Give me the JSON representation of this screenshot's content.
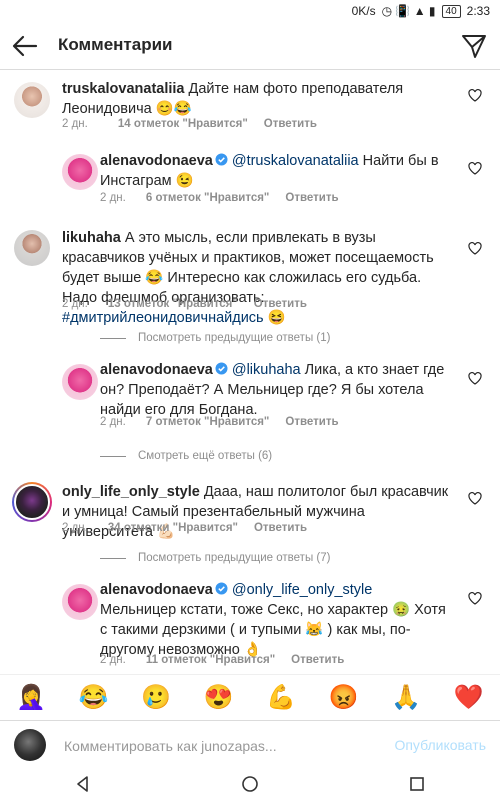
{
  "status": {
    "speed": "0K/s",
    "battery": "40",
    "time": "2:33"
  },
  "header": {
    "title": "Комментарии"
  },
  "comments": [
    {
      "user": "truskalovanataliia",
      "text": "Дайте нам фото преподавателя Леонидовича 😊😂",
      "time": "2 дн.",
      "likes": "14 отметок \"Нравится\"",
      "reply": "Ответить"
    },
    {
      "user": "alenavodonaeva",
      "mention": "@truskalovanataliia",
      "text": " Найти бы в Инстаграм 😉",
      "time": "2 дн.",
      "likes": "6 отметок \"Нравится\"",
      "reply": "Ответить"
    },
    {
      "user": "likuhaha",
      "text": "А это мысль, если привлекать в вузы красавчиков учёных и практиков, может посещаемость будет выше 😂 Интересно как сложилась его судьба. Надо флешмоб организовать: ",
      "hashtag": "#дмитрийлеонидовичнайдись",
      "text2": " 😆",
      "time": "2 дн.",
      "likes": "13 отметок \"Нравится\"",
      "reply": "Ответить"
    },
    {
      "user": "alenavodonaeva",
      "mention": "@likuhaha",
      "text": " Лика, а кто знает где он? Преподаёт? А Мельницер где? Я бы хотела найди его для Богдана.",
      "time": "2 дн.",
      "likes": "7 отметок \"Нравится\"",
      "reply": "Ответить"
    },
    {
      "user": "only_life_only_style",
      "text": "Дааа, наш политолог был красавчик и умница! Самый презентабельный мужчина университета 💪🏻",
      "time": "2 дн.",
      "likes": "34 отметки \"Нравится\"",
      "reply": "Ответить"
    },
    {
      "user": "alenavodonaeva",
      "mention": "@only_life_only_style",
      "text": " Мельницер кстати, тоже Секс, но характер 🤢 Хотя с такими дерзкими ( и тупыми 😹 ) как мы, по-другому невозможно 👌",
      "time": "2 дн.",
      "likes": "11 отметок \"Нравится\"",
      "reply": "Ответить"
    }
  ],
  "threads": [
    {
      "label": "Посмотреть предыдущие ответы (1)"
    },
    {
      "label": "Смотреть ещё ответы (6)"
    },
    {
      "label": "Посмотреть предыдущие ответы (7)"
    }
  ],
  "emojis": [
    "🤦‍♀️",
    "😂",
    "🥲",
    "😍",
    "💪",
    "😡",
    "🙏",
    "❤️"
  ],
  "composer": {
    "placeholder": "Комментировать как junozapas...",
    "post": "Опубликовать"
  },
  "icons": {
    "back": "back-arrow-icon",
    "send": "send-icon",
    "heart": "heart-icon",
    "verified": "verified-badge-icon"
  }
}
